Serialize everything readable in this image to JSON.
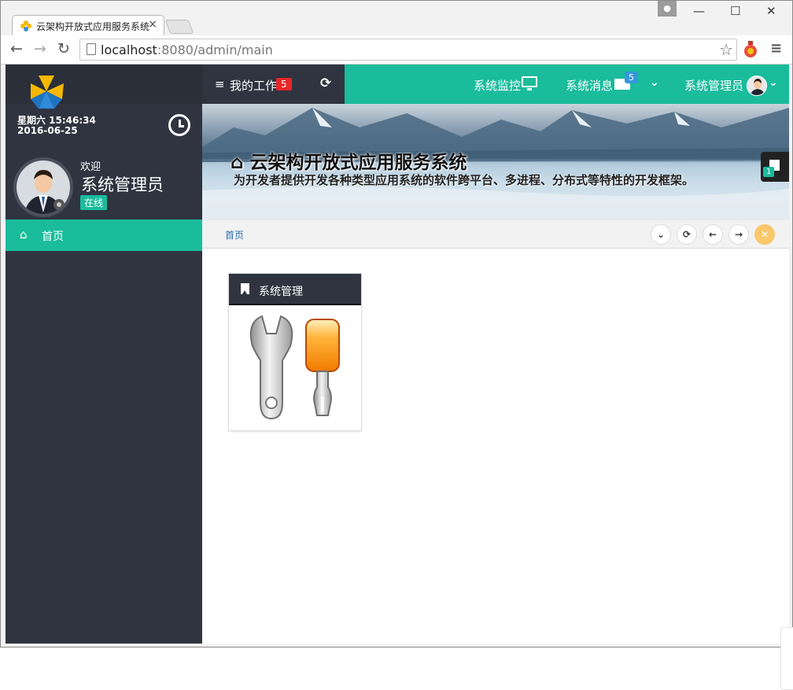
{
  "browser": {
    "tab_title": "云架构开放式应用服务系统",
    "tab_close": "×",
    "url_host": "localhost",
    "url_rest": ":8080/admin/main",
    "window_controls": {
      "minimize": "—",
      "maximize": "☐",
      "close": "✕"
    },
    "icons": [
      "back-arrow-icon",
      "forward-arrow-icon",
      "reload-icon",
      "page-icon",
      "star-icon",
      "extension-icon",
      "menu-icon",
      "profile-icon"
    ]
  },
  "sidebar": {
    "date_line1": "星期六 15:46:34",
    "date_line2": "2016-06-25",
    "welcome": "欢迎",
    "user_name": "系统管理员",
    "status": "在线",
    "menu": [
      {
        "label": "首页",
        "icon": "home-icon",
        "active": true
      }
    ]
  },
  "topbar": {
    "my_work_label": "我的工作",
    "my_work_count": "5",
    "monitor_label": "系统监控",
    "messages_label": "系统消息",
    "messages_count": "5",
    "admin_label": "系统管理员",
    "accent_color": "#1abc9c",
    "dark_color": "#2f3440"
  },
  "banner": {
    "title": "云架构开放式应用服务系统",
    "subtitle": "为开发者提供开发各种类型应用系统的软件跨平台、多进程、分布式等特性的开发框架。",
    "side_badge": "1"
  },
  "breadcrumb": {
    "home": "首页",
    "controls": [
      "chevron-down-icon",
      "refresh-icon",
      "arrow-left-icon",
      "arrow-right-icon",
      "close-icon"
    ]
  },
  "modules": [
    {
      "title": "系统管理",
      "icon": "tools-icon"
    }
  ]
}
